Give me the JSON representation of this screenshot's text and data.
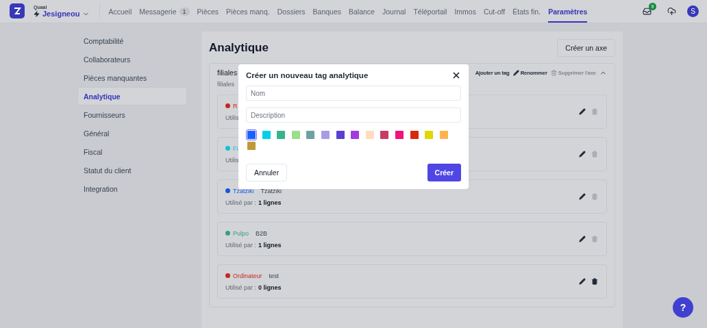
{
  "brand": {
    "workspace": "Quaal",
    "company": "Jesigneou"
  },
  "nav": [
    {
      "label": "Accueil",
      "selected": false
    },
    {
      "label": "Messagerie",
      "badge": "1",
      "selected": false
    },
    {
      "label": "Pièces",
      "selected": false
    },
    {
      "label": "Pièces manq.",
      "selected": false
    },
    {
      "label": "Dossiers",
      "selected": false
    },
    {
      "label": "Banques",
      "selected": false
    },
    {
      "label": "Balance",
      "selected": false
    },
    {
      "label": "Journal",
      "selected": false
    },
    {
      "label": "Téléportail",
      "selected": false
    },
    {
      "label": "Immos",
      "selected": false
    },
    {
      "label": "Cut-off",
      "selected": false
    },
    {
      "label": "États fin.",
      "selected": false
    },
    {
      "label": "Paramètres",
      "selected": true
    }
  ],
  "notifications": {
    "count": "9"
  },
  "avatar": "S",
  "sidebar": {
    "items": [
      {
        "label": "Comptabilité",
        "selected": false
      },
      {
        "label": "Collaborateurs",
        "selected": false
      },
      {
        "label": "Pièces manquantes",
        "selected": false
      },
      {
        "label": "Analytique",
        "selected": true
      },
      {
        "label": "Fournisseurs",
        "selected": false
      },
      {
        "label": "Général",
        "selected": false
      },
      {
        "label": "Fiscal",
        "selected": false
      },
      {
        "label": "Statut du client",
        "selected": false
      },
      {
        "label": "Integration",
        "selected": false
      }
    ]
  },
  "page": {
    "title": "Analytique",
    "create_button": "Créer un axe"
  },
  "axis": {
    "name": "filiales",
    "subtitle": "filiales",
    "actions": [
      {
        "label": "Ajouter un tag",
        "disabled": false
      },
      {
        "label": "Renommer",
        "disabled": false
      },
      {
        "label": "Supprimer l'axe",
        "disabled": true
      }
    ],
    "expanded": true,
    "tags": [
      {
        "name": "R",
        "color": "#c8281c",
        "usage_label": "Utilis",
        "deletable": false
      },
      {
        "name": "Fi",
        "color": "#12c2d8",
        "usage_label": "Utilis",
        "deletable": false
      },
      {
        "name": "Tzatziki",
        "color": "#1656e0",
        "description": "Tzatziki",
        "usage_label": "Utilisé par :",
        "usage": "1 lignes",
        "deletable": false
      },
      {
        "name": "Pulpo",
        "color": "#3a9e7a",
        "description": "B2B",
        "usage_label": "Utilisé par :",
        "usage": "1 lignes",
        "deletable": false
      },
      {
        "name": "Ordinateur",
        "color": "#c8281c",
        "description": "test",
        "usage_label": "Utilisé par :",
        "usage": "0 lignes",
        "deletable": true
      }
    ]
  },
  "modal": {
    "title": "Créer un nouveau tag analytique",
    "name_placeholder": "Nom",
    "description_placeholder": "Description",
    "colors": [
      {
        "color": "#1a62ff",
        "selected": true
      },
      {
        "color": "#00d0e8",
        "selected": false
      },
      {
        "color": "#38b48c",
        "selected": false
      },
      {
        "color": "#9ae08a",
        "selected": false
      },
      {
        "color": "#6fa0a4",
        "selected": false
      },
      {
        "color": "#a89be8",
        "selected": false
      },
      {
        "color": "#5a3fd0",
        "selected": false
      },
      {
        "color": "#a23ae0",
        "selected": false
      },
      {
        "color": "#ffdcc0",
        "selected": false
      },
      {
        "color": "#c73c63",
        "selected": false
      },
      {
        "color": "#f0137a",
        "selected": false
      },
      {
        "color": "#d82a10",
        "selected": false
      },
      {
        "color": "#e0d800",
        "selected": false
      },
      {
        "color": "#ffb44c",
        "selected": false
      },
      {
        "color": "#c09a3a",
        "selected": false
      }
    ],
    "cancel": "Annuler",
    "submit": "Créer"
  },
  "help": "?"
}
